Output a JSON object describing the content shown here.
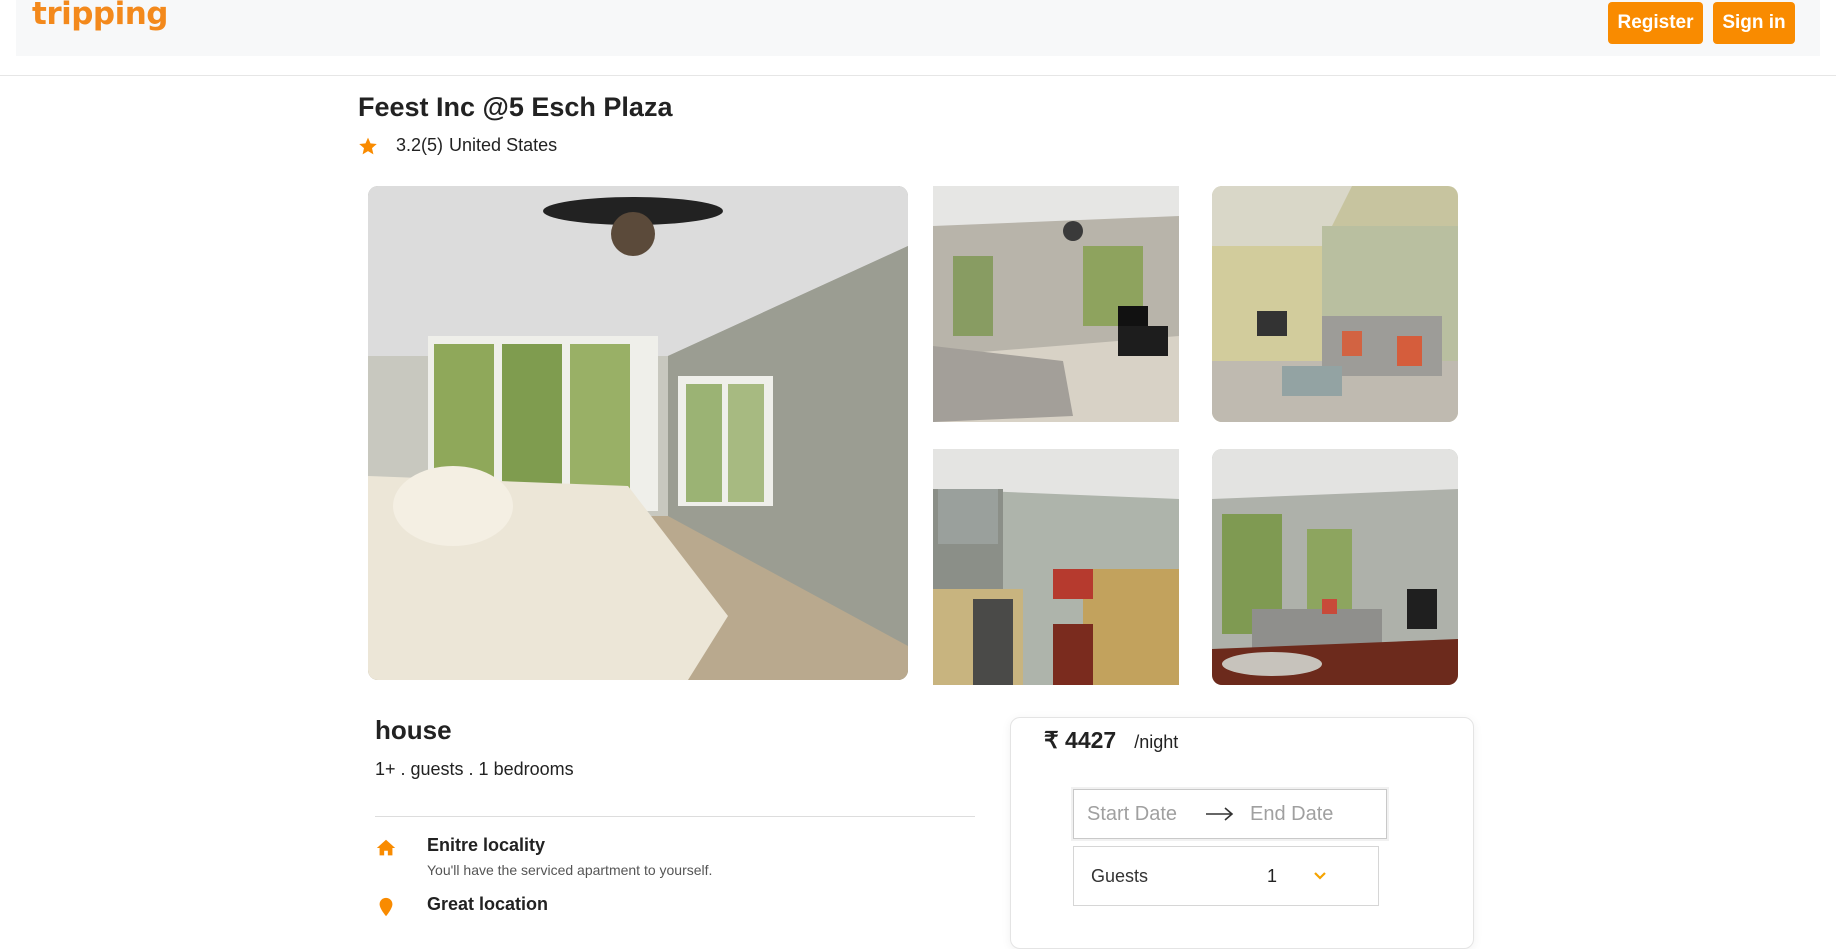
{
  "header": {
    "logo_text": "tripping",
    "register_label": "Register",
    "signin_label": "Sign in",
    "accent_color": "#f98b00"
  },
  "listing": {
    "title": "Feest Inc @5 Esch Plaza",
    "rating": "3.2(5)",
    "country": "United States",
    "rating_icon": "star-icon",
    "photos": [
      {
        "name": "main-bedroom-photo"
      },
      {
        "name": "bedroom-living-photo"
      },
      {
        "name": "study-lounge-photo"
      },
      {
        "name": "kitchen-photo"
      },
      {
        "name": "living-room-photo"
      }
    ]
  },
  "details": {
    "property_type": "house",
    "info": "1+ . guests . 1 bedrooms",
    "features": [
      {
        "icon": "home-icon",
        "title": "Enitre locality",
        "description": "You'll have the serviced apartment to yourself."
      },
      {
        "icon": "location-pin-icon",
        "title": "Great location",
        "description": ""
      }
    ]
  },
  "booking": {
    "price": "₹ 4427",
    "per_night": "/night",
    "start_date_placeholder": "Start Date",
    "end_date_placeholder": "End Date",
    "guests_label": "Guests",
    "guests_value": "1"
  }
}
